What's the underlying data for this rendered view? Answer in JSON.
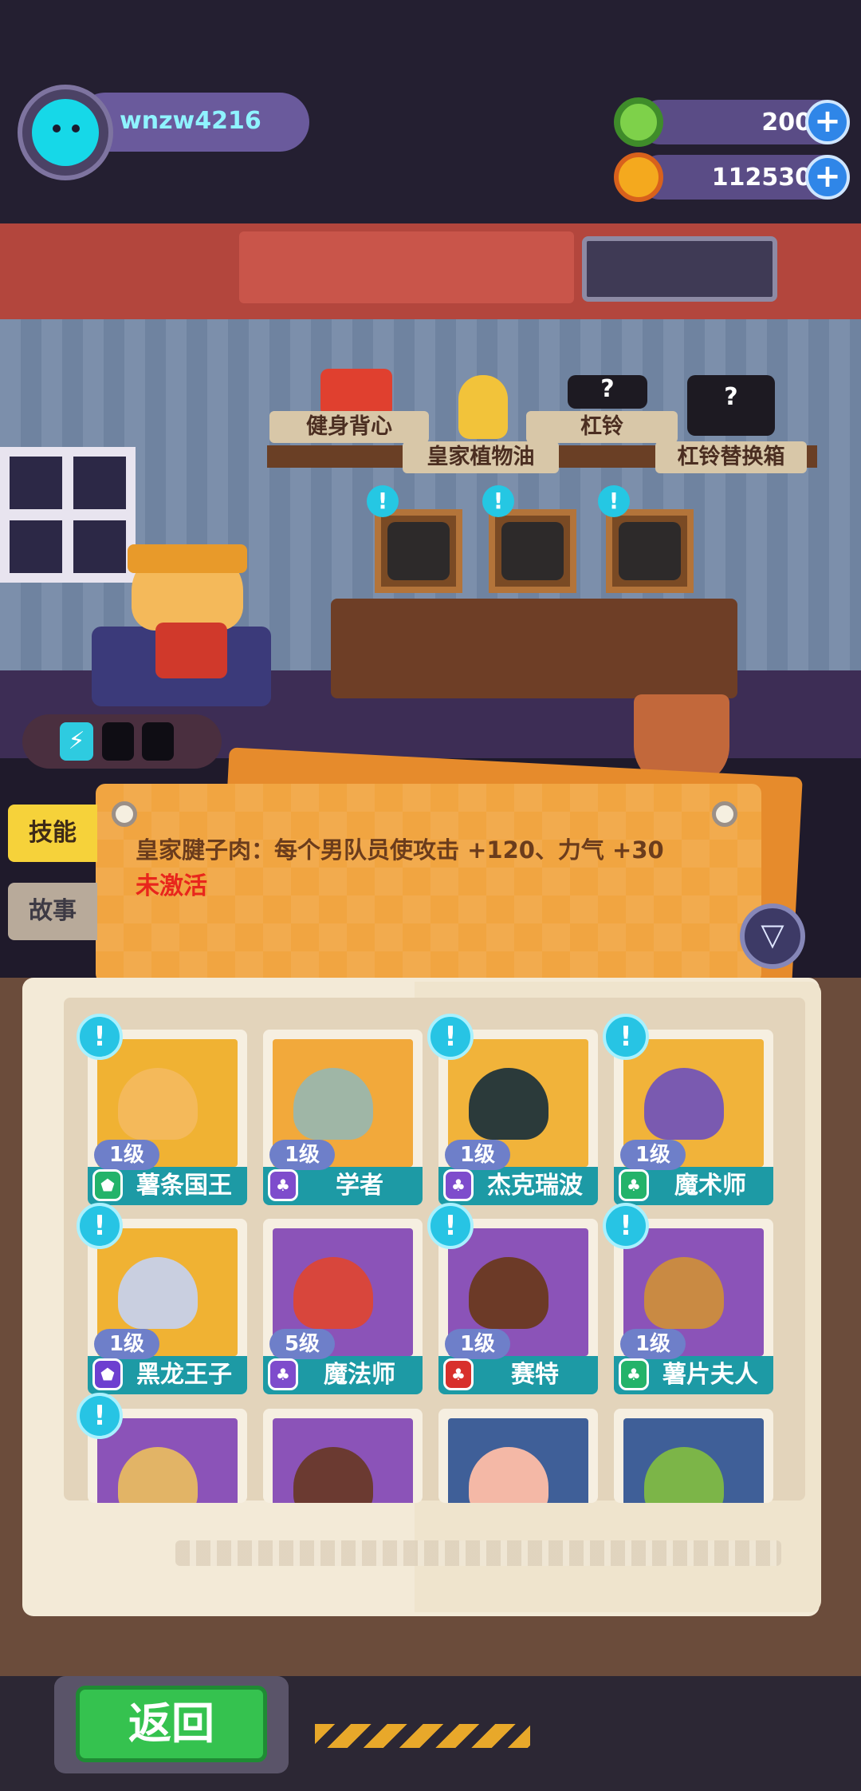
{
  "player": {
    "name": "wnzw4216",
    "avatar_icon": "cat-face-icon"
  },
  "currencies": [
    {
      "icon": "donut-icon",
      "value": "200",
      "plus": "+"
    },
    {
      "icon": "planet-coin-icon",
      "value": "112530",
      "plus": "+"
    }
  ],
  "shelf_items": [
    "健身背心",
    "皇家植物油",
    "杠铃",
    "杠铃替换箱"
  ],
  "side_tabs": [
    "技能",
    "故事"
  ],
  "skill": {
    "text": "皇家腱子肉：每个男队员使攻击 +120、力气 +30",
    "status": "未激活"
  },
  "energy": {
    "icon": "lightning-icon",
    "slots": 2
  },
  "characters": [
    {
      "name": "薯条国王",
      "level": "1级",
      "alert": true,
      "art": "#f0b233",
      "face": "#f4b95a",
      "badge": "#23b36a",
      "badge_icon": "shield-icon"
    },
    {
      "name": "学者",
      "level": "1级",
      "alert": false,
      "art": "#f2a93b",
      "face": "#9fb6a6",
      "badge": "#7e4ccc",
      "badge_icon": "leaf-icon"
    },
    {
      "name": "杰克瑞波",
      "level": "1级",
      "alert": true,
      "art": "#f1b33a",
      "face": "#2b3a3a",
      "badge": "#7e4ccc",
      "badge_icon": "leaf-icon"
    },
    {
      "name": "魔术师",
      "level": "1级",
      "alert": true,
      "art": "#f1b33a",
      "face": "#7a5ab0",
      "badge": "#23b36a",
      "badge_icon": "leaf-icon"
    },
    {
      "name": "黑龙王子",
      "level": "1级",
      "alert": true,
      "art": "#f0b233",
      "face": "#c9cfe0",
      "badge": "#6d3fd0",
      "badge_icon": "shield-icon"
    },
    {
      "name": "魔法师",
      "level": "5级",
      "alert": false,
      "art": "#8b53b8",
      "face": "#d8463c",
      "badge": "#7e4ccc",
      "badge_icon": "leaf-icon"
    },
    {
      "name": "赛特",
      "level": "1级",
      "alert": true,
      "art": "#8b53b8",
      "face": "#6c3a27",
      "badge": "#d8302c",
      "badge_icon": "leaf-icon"
    },
    {
      "name": "薯片夫人",
      "level": "1级",
      "alert": true,
      "art": "#8b53b8",
      "face": "#c98a43",
      "badge": "#23b36a",
      "badge_icon": "leaf-icon"
    },
    {
      "name": "",
      "level": "",
      "alert": true,
      "art": "#8b53b8",
      "face": "#e2b466"
    },
    {
      "name": "",
      "level": "",
      "alert": false,
      "art": "#8b53b8",
      "face": "#6b3a31"
    },
    {
      "name": "",
      "level": "",
      "alert": false,
      "art": "#3f5f98",
      "face": "#f4b8a6"
    },
    {
      "name": "",
      "level": "",
      "alert": false,
      "art": "#3f5f98",
      "face": "#7cb548"
    }
  ],
  "back_button": "返回"
}
